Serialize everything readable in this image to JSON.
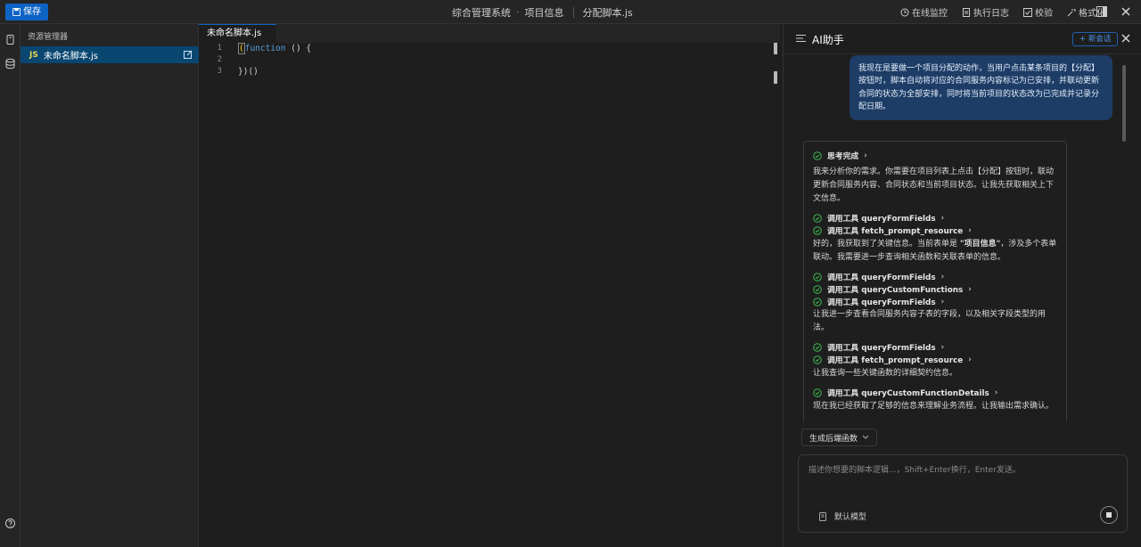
{
  "topbar": {
    "save_label": "保存",
    "breadcrumb": [
      "综合管理系统",
      "项目信息"
    ],
    "file_name": "分配脚本.js",
    "actions": [
      "在线监控",
      "执行日志",
      "校验",
      "格式化"
    ]
  },
  "explorer": {
    "title": "资源管理器",
    "file_badge": "JS",
    "file_name": "未命名脚本.js"
  },
  "editor": {
    "tab": "未命名脚本.js",
    "line_numbers": [
      "1",
      "2",
      "3"
    ],
    "code_line1_kw": "function",
    "code_line1_rest": " () {",
    "code_line3": "})()"
  },
  "ai": {
    "title": "AI助手",
    "new_chat": "+ 新会话",
    "user_message": "我现在是要做一个项目分配的动作，当用户点击某条项目的【分配】按钮时，脚本自动将对应的合同服务内容标记为已安排，并联动更新合同的状态为全部安排，同时将当前项目的状态改为已完成并记录分配日期。",
    "thinking": "思考完成",
    "text1": "我来分析你的需求。你需要在项目列表上点击【分配】按钮时，联动更新合同服务内容、合同状态和当前项目状态。让我先获取相关上下文信息。",
    "tool_calls_1": [
      "调用工具 queryFormFields",
      "调用工具 fetch_prompt_resource"
    ],
    "text2_pre": "好的，我获取到了关键信息。当前表单是 ",
    "text2_bold": "\"项目信息\"",
    "text2_post": "，涉及多个表单联动。我需要进一步查询相关函数和关联表单的信息。",
    "tool_calls_2": [
      "调用工具 queryFormFields",
      "调用工具 queryCustomFunctions",
      "调用工具 queryFormFields"
    ],
    "text3": "让我进一步查看合同服务内容子表的字段，以及相关字段类型的用法。",
    "tool_calls_3": [
      "调用工具 queryFormFields",
      "调用工具 fetch_prompt_resource"
    ],
    "text4": "让我查询一些关键函数的详细契约信息。",
    "tool_calls_4": [
      "调用工具 queryCustomFunctionDetails"
    ],
    "text5": "现在我已经获取了足够的信息来理解业务流程。让我输出需求确认。",
    "gen_select": "生成后端函数",
    "input_placeholder": "描述你想要的脚本逻辑...，Shift+Enter换行，Enter发送。",
    "model": "默认模型"
  },
  "colors": {
    "accent": "#0e63c4",
    "check": "#3fb950",
    "user_bubble": "#1d3d66"
  }
}
